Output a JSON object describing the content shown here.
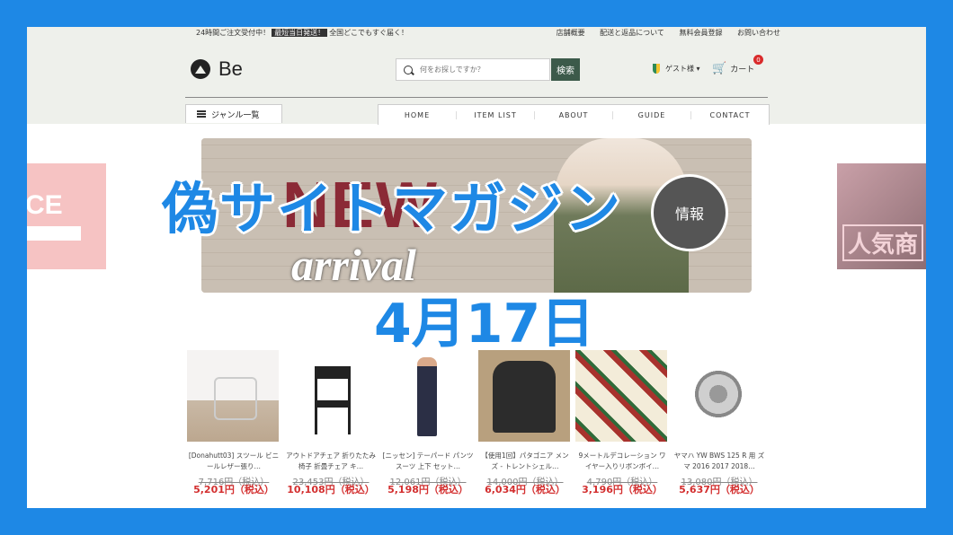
{
  "overlay": {
    "title": "偽サイトマガジン",
    "date": "4月17日"
  },
  "topbar": {
    "left_text": "24時間ご注文受付中！",
    "badge": "最短当日発送！",
    "right_text": "全国どこでもすぐ届く！",
    "links": [
      "店舗概要",
      "配送と返品について",
      "無料会員登録",
      "お問い合わせ"
    ]
  },
  "header": {
    "logo_text": "Be",
    "search_placeholder": "何をお探しですか？",
    "search_button": "検索",
    "guest_label": "ゲスト様",
    "cart_label": "カート",
    "cart_count": "0"
  },
  "nav": {
    "genre_label": "ジャンル一覧",
    "items": [
      "HOME",
      "ITEM LIST",
      "ABOUT",
      "GUIDE",
      "CONTACT"
    ]
  },
  "hero": {
    "headline": "NEW",
    "subline": "arrival",
    "badge": "情報"
  },
  "promo": {
    "left_text": "CE",
    "right_text": "人気商"
  },
  "products": [
    {
      "name": "[Donahutt03] スツール ビニールレザー張り…",
      "orig_price": "7,716円（税込）",
      "price": "5,201円（税込）"
    },
    {
      "name": "アウトドアチェア 折りたたみ椅子 折畳チェア キ…",
      "orig_price": "23,453円（税込）",
      "price": "10,108円（税込）"
    },
    {
      "name": "[ニッセン] テーパード パンツスーツ 上下 セット…",
      "orig_price": "12,061円（税込）",
      "price": "5,198円（税込）"
    },
    {
      "name": "【使用1回】パタゴニア メンズ - トレントシェル…",
      "orig_price": "14,000円（税込）",
      "price": "6,034円（税込）"
    },
    {
      "name": "9メートルデコレーション ワイヤー入りリボンボイ…",
      "orig_price": "4,790円（税込）",
      "price": "3,196円（税込）"
    },
    {
      "name": "ヤマハ YW BWS 125 R 用 ズマ 2016 2017 2018…",
      "orig_price": "13,080円（税込）",
      "price": "5,637円（税込）"
    }
  ]
}
